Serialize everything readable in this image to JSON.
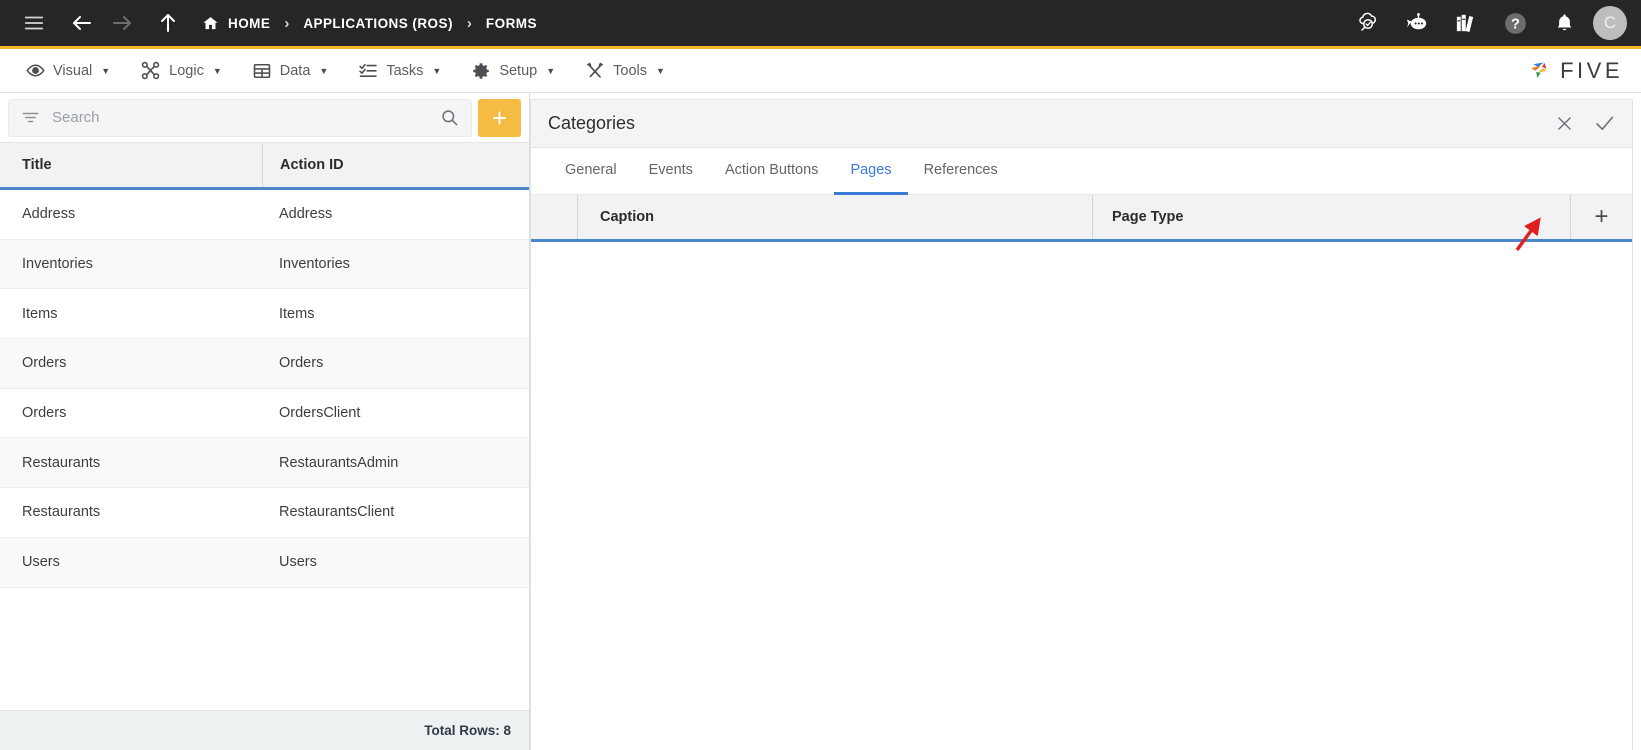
{
  "topbar": {
    "menu_icon": "hamburger-icon",
    "back_icon": "arrow-left-icon",
    "forward_icon": "arrow-right-icon",
    "up_icon": "arrow-up-icon",
    "home_icon": "home-icon",
    "breadcrumb": [
      {
        "label": "HOME"
      },
      {
        "label": "APPLICATIONS (ROS)"
      },
      {
        "label": "FORMS"
      }
    ],
    "separator": "›",
    "right_icons": [
      {
        "name": "cloud-search-icon"
      },
      {
        "name": "chatbot-icon"
      },
      {
        "name": "books-library-icon"
      },
      {
        "name": "help-icon"
      },
      {
        "name": "notifications-bell-icon"
      }
    ],
    "avatar_initial": "C",
    "accent_color": "#f5b324",
    "background_color": "#262626"
  },
  "menubar": {
    "items": [
      {
        "label": "Visual",
        "icon": "eye-icon",
        "caret": "▼"
      },
      {
        "label": "Logic",
        "icon": "logic-nodes-icon",
        "caret": "▼"
      },
      {
        "label": "Data",
        "icon": "table-grid-icon",
        "caret": "▼"
      },
      {
        "label": "Tasks",
        "icon": "checklist-icon",
        "caret": "▼"
      },
      {
        "label": "Setup",
        "icon": "gear-icon",
        "caret": "▼"
      },
      {
        "label": "Tools",
        "icon": "tools-wrench-icon",
        "caret": "▼"
      }
    ],
    "brand": {
      "word": "FIVE",
      "logo": "five-pinwheel-logo"
    }
  },
  "left_panel": {
    "search": {
      "placeholder": "Search",
      "value": "",
      "filter_icon": "filter-icon",
      "search_icon": "search-icon"
    },
    "add_button": {
      "label": "+",
      "name": "add-record-button",
      "color": "#f6bb42"
    },
    "columns": [
      "Title",
      "Action ID"
    ],
    "rows": [
      {
        "title": "Address",
        "action_id": "Address"
      },
      {
        "title": "Inventories",
        "action_id": "Inventories"
      },
      {
        "title": "Items",
        "action_id": "Items"
      },
      {
        "title": "Orders",
        "action_id": "Orders"
      },
      {
        "title": "Orders",
        "action_id": "OrdersClient"
      },
      {
        "title": "Restaurants",
        "action_id": "RestaurantsAdmin"
      },
      {
        "title": "Restaurants",
        "action_id": "RestaurantsClient"
      },
      {
        "title": "Users",
        "action_id": "Users"
      }
    ],
    "footer": "Total Rows: 8"
  },
  "right_panel": {
    "title": "Categories",
    "close_icon": "close-icon",
    "confirm_icon": "check-icon",
    "tabs": [
      {
        "label": "General",
        "active": false
      },
      {
        "label": "Events",
        "active": false
      },
      {
        "label": "Action Buttons",
        "active": false
      },
      {
        "label": "Pages",
        "active": true
      },
      {
        "label": "References",
        "active": false
      }
    ],
    "table": {
      "columns": [
        "Caption",
        "Page Type"
      ],
      "add_button": "+",
      "rows": []
    },
    "annotation": {
      "type": "red-arrow",
      "color": "#e02020",
      "points_to": "add-page-button"
    }
  }
}
